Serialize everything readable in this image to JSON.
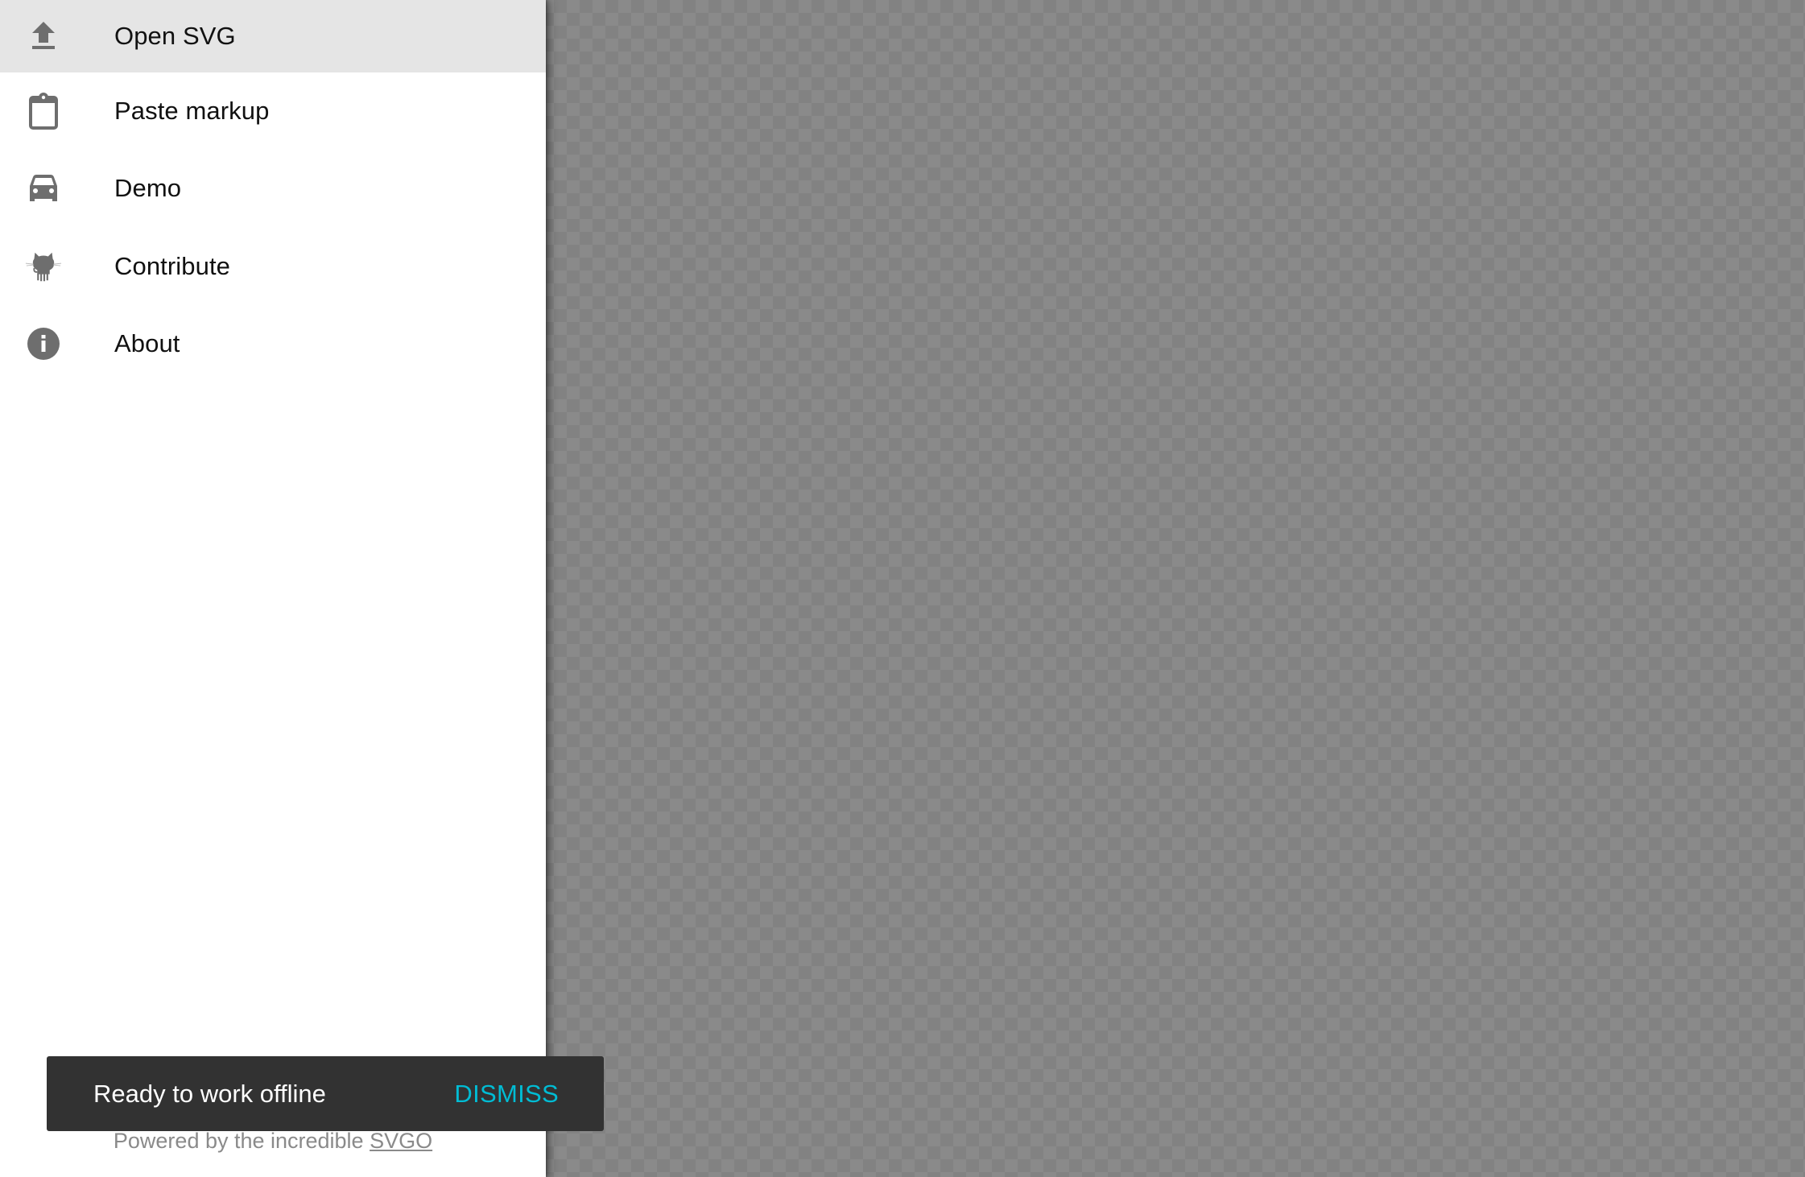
{
  "menu": {
    "items": [
      {
        "label": "Open SVG",
        "icon": "upload-icon",
        "active": true
      },
      {
        "label": "Paste markup",
        "icon": "clipboard-icon",
        "active": false
      },
      {
        "label": "Demo",
        "icon": "car-icon",
        "active": false
      },
      {
        "label": "Contribute",
        "icon": "github-octocat-icon",
        "active": false
      },
      {
        "label": "About",
        "icon": "info-icon",
        "active": false
      }
    ]
  },
  "footer": {
    "prefix": "Powered by the incredible ",
    "link_label": "SVGO"
  },
  "snackbar": {
    "message": "Ready to work offline",
    "action_label": "DISMISS"
  },
  "colors": {
    "accent": "#00bcd4",
    "icon": "#6e6e6e",
    "active_row": "#e5e5e5",
    "snackbar_bg": "#323232",
    "checker_light": "#8a8a8a",
    "checker_dark": "#828282"
  }
}
